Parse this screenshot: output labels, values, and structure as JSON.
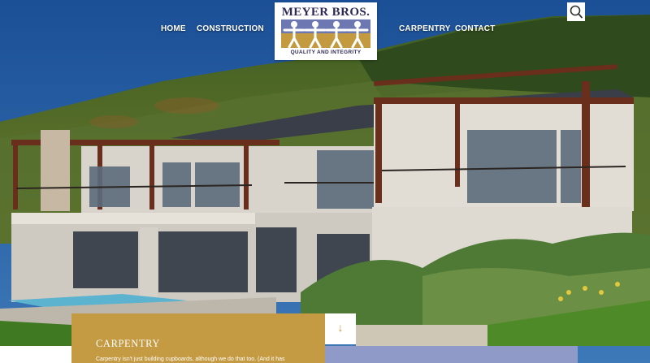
{
  "nav": {
    "home": "HOME",
    "construction": "CONSTRUCTION",
    "carpentry": "CARPENTRY",
    "contact": "CONTACT"
  },
  "logo": {
    "name": "MEYER BROS.",
    "tagline": "QUALITY AND INTEGRITY"
  },
  "search": {
    "icon": "search-icon"
  },
  "card": {
    "title": "CARPENTRY",
    "text": "Carpentry isn't just building cupboards, although we do that too. (And it has",
    "down_icon": "↓"
  },
  "colors": {
    "gold": "#c49a42",
    "lavender": "#8f9ac9",
    "logo_navy": "#2e2a55",
    "logo_blue": "#6d78b3"
  }
}
